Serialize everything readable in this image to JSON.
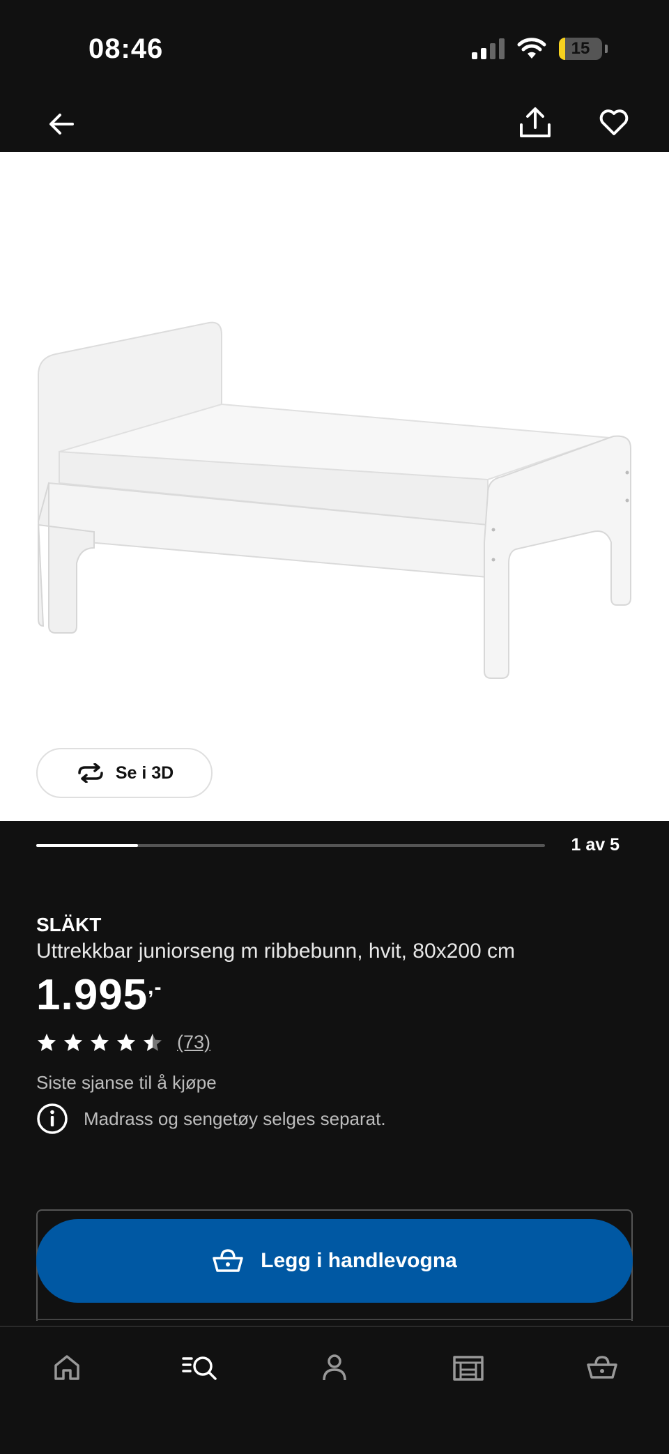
{
  "status_bar": {
    "time": "08:46",
    "battery": "15",
    "battery_level": 0.15
  },
  "product": {
    "brand": "SLÄKT",
    "description": "Uttrekkbar juniorseng m ribbebunn, hvit, 80x200 cm",
    "price": "1.995",
    "price_suffix": ",-",
    "rating": 4.5,
    "rating_max": 5,
    "review_count": "(73)",
    "availability": "Siste sjanse til å kjøpe",
    "info": "Madrass og sengetøy selges separat."
  },
  "gallery": {
    "see_3d_label": "Se i 3D",
    "counter": "1 av 5",
    "progress": 0.2
  },
  "actions": {
    "add_to_cart_label": "Legg i handlevogna"
  },
  "icons": {
    "back": "arrow-left-icon",
    "share": "share-icon",
    "favorite": "heart-icon",
    "rotate_3d": "rotate-3d-icon",
    "info": "info-circle-icon",
    "cart": "basket-icon"
  },
  "tabs": [
    "home-icon",
    "search-list-icon",
    "profile-icon",
    "store-icon",
    "basket-icon"
  ],
  "colors": {
    "accent": "#0058a3",
    "background": "#111111",
    "battery": "#f7d21f"
  }
}
